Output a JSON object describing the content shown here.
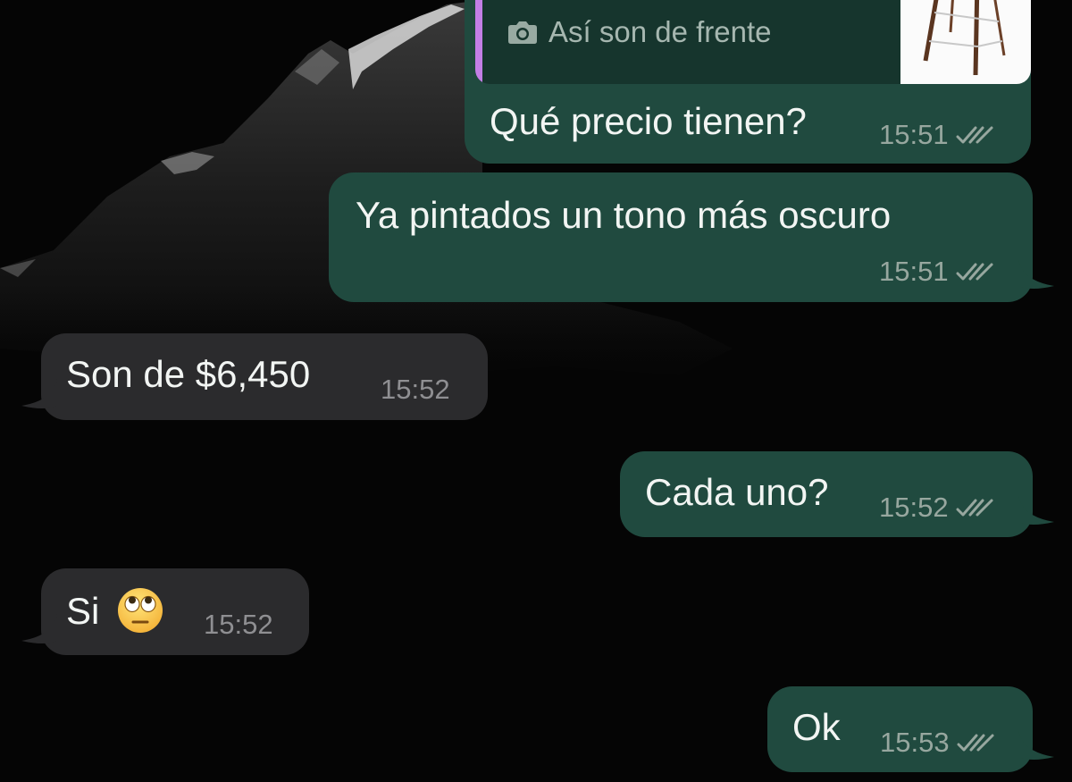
{
  "colors": {
    "outgoing_bubble": "#204a3f",
    "incoming_bubble": "#2b2b2d",
    "quote_accent": "#c37ee6",
    "background": "#050505"
  },
  "messages": [
    {
      "direction": "outgoing",
      "quoted": {
        "icon": "camera-icon",
        "text": "Así son de frente",
        "thumbnail": "bar-stool-photo"
      },
      "text": "Qué precio tienen?",
      "time": "15:51",
      "status": "double-check-icon"
    },
    {
      "direction": "outgoing",
      "text": "Ya pintados un tono más oscuro",
      "time": "15:51",
      "status": "double-check-icon"
    },
    {
      "direction": "incoming",
      "text": "Son de $6,450",
      "time": "15:52"
    },
    {
      "direction": "outgoing",
      "text": "Cada uno?",
      "time": "15:52",
      "status": "double-check-icon"
    },
    {
      "direction": "incoming",
      "text": "Si",
      "emoji": "face-with-rolling-eyes-icon",
      "time": "15:52"
    },
    {
      "direction": "outgoing",
      "text": "Ok",
      "time": "15:53",
      "status": "double-check-icon"
    }
  ]
}
